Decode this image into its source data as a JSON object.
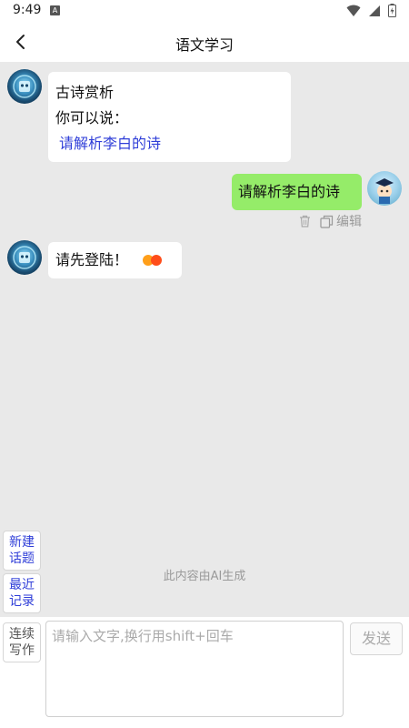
{
  "status_bar": {
    "time": "9:49",
    "notif_glyph": "A"
  },
  "nav": {
    "title": "语文学习"
  },
  "messages": [
    {
      "lines": [
        "古诗赏析",
        "你可以说："
      ],
      "suggestion": "请解析李白的诗"
    },
    {
      "text": "请解析李白的诗"
    },
    {
      "text": "请先登陆！"
    }
  ],
  "actions": {
    "edit_label": "编辑"
  },
  "disclaimer": "此内容由AI生成",
  "side_buttons": {
    "new_topic": [
      "新建",
      "话题"
    ],
    "recent": [
      "最近",
      "记录"
    ],
    "continue": [
      "连续",
      "写作"
    ]
  },
  "composer": {
    "placeholder": "请输入文字,换行用shift+回车",
    "send_label": "发送"
  },
  "colors": {
    "user_bubble": "#95ec69",
    "link": "#2f3ed8",
    "typing_dot_1": "#ff9f1a",
    "typing_dot_2": "#ff4d1a"
  }
}
